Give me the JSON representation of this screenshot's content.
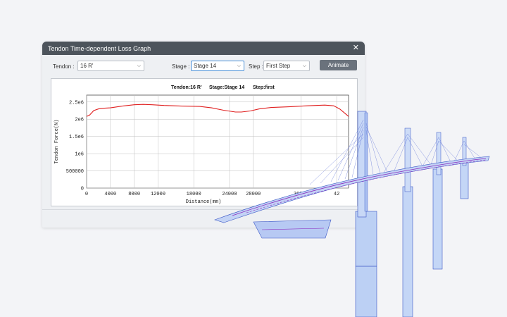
{
  "dialog": {
    "title": "Tendon Time-dependent Loss Graph",
    "close_label": "✕"
  },
  "controls": {
    "tendon_label": "Tendon :",
    "tendon_value": "16 R'",
    "stage_label": "Stage :",
    "stage_value": "Stage 14",
    "step_label": "Step :",
    "step_value": "First Step",
    "animate_label": "Animate"
  },
  "icons": {
    "dropdown": "chevron-down-icon",
    "close": "close-icon"
  },
  "chart_data": {
    "type": "line",
    "title_parts": [
      "Tendon:16 R'",
      "Stage:Stage 14",
      "Step:first"
    ],
    "xlabel": "Distance(mm)",
    "ylabel": "Tendon Force(N)",
    "xlim": [
      0,
      44000
    ],
    "ylim": [
      0,
      2700000
    ],
    "x_ticks": [
      0,
      4000,
      8000,
      12000,
      18000,
      24000,
      28000,
      36000,
      42000
    ],
    "y_ticks": [
      0,
      500000,
      1000000,
      1500000,
      2000000,
      2500000
    ],
    "y_tick_labels": [
      "0",
      "500000",
      "1e6",
      "1.5e6",
      "2e6",
      "2.5e6"
    ],
    "x_tick_labels": [
      "0",
      "4000",
      "8000",
      "12000",
      "18000",
      "24000",
      "28000",
      "36000",
      "42"
    ],
    "grid": true,
    "series": [
      {
        "color": "#e02020",
        "x": [
          0,
          500,
          1200,
          2000,
          3000,
          4000,
          6000,
          8000,
          9500,
          11000,
          13000,
          16000,
          19000,
          21000,
          23000,
          25000,
          26000,
          27500,
          29000,
          31000,
          34000,
          37000,
          40000,
          41500,
          42500,
          43200,
          44000
        ],
        "y": [
          2080000,
          2120000,
          2250000,
          2300000,
          2320000,
          2330000,
          2380000,
          2420000,
          2430000,
          2420000,
          2400000,
          2380000,
          2370000,
          2330000,
          2260000,
          2210000,
          2210000,
          2240000,
          2300000,
          2340000,
          2360000,
          2390000,
          2410000,
          2390000,
          2300000,
          2200000,
          2080000
        ]
      }
    ]
  }
}
